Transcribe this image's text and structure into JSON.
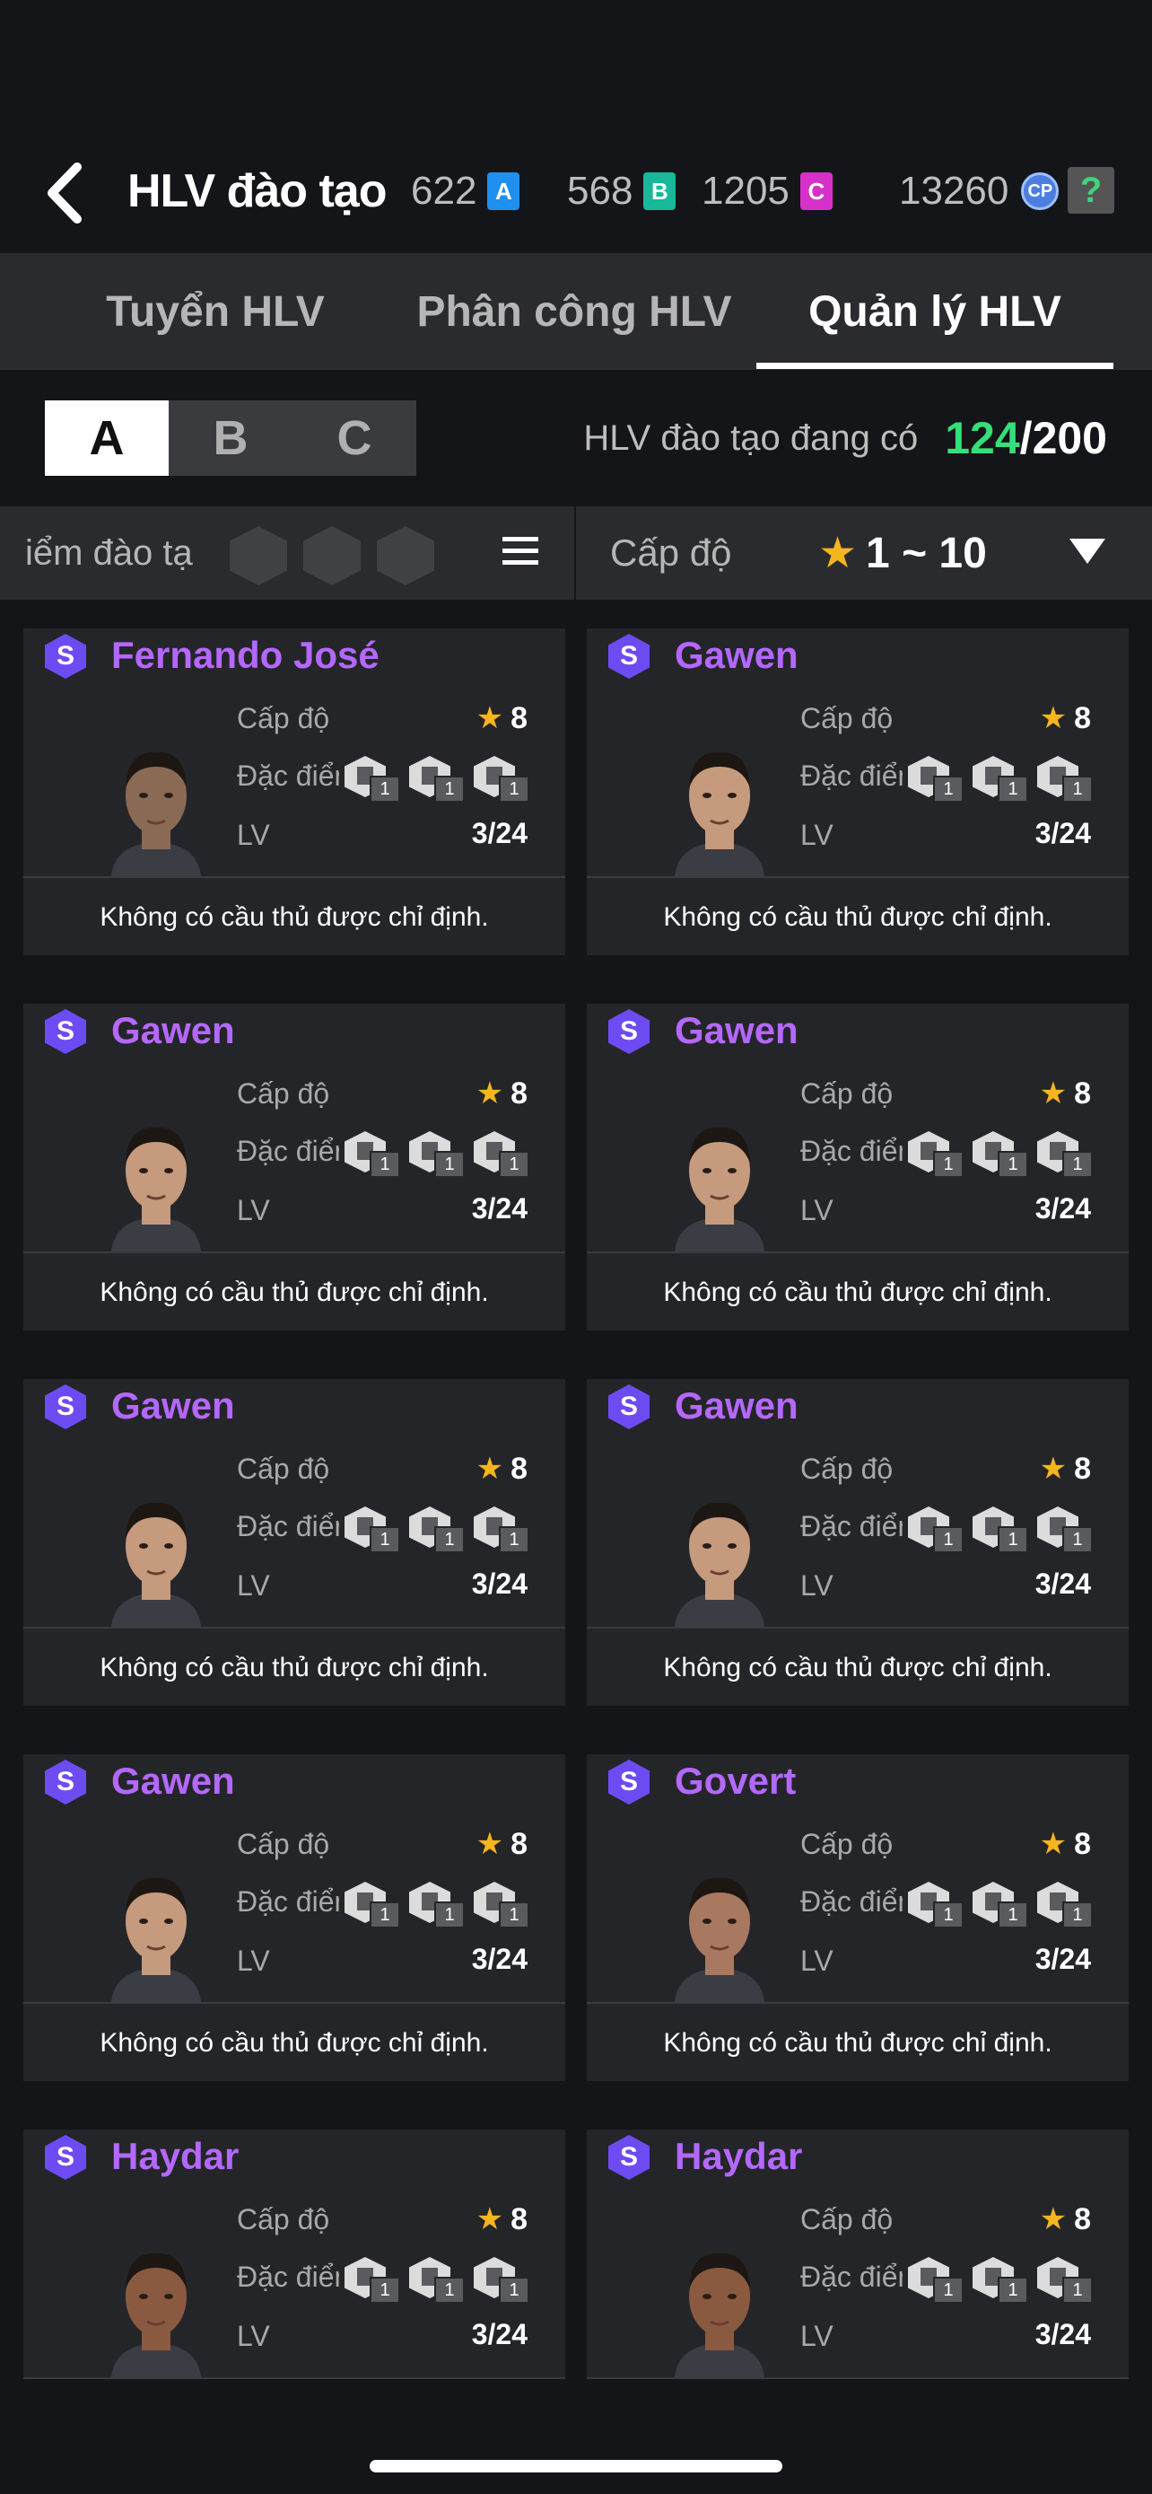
{
  "header": {
    "title": "HLV đào tạo",
    "currencies": [
      {
        "value": "622",
        "badge": "A",
        "color": "#1f8ff0"
      },
      {
        "value": "568",
        "badge": "B",
        "color": "#17b99a"
      },
      {
        "value": "1205",
        "badge": "C",
        "color": "#d531c8"
      }
    ],
    "cp_value": "13260",
    "cp_label": "CP",
    "help": "?"
  },
  "tabs": [
    {
      "label": "Tuyển HLV",
      "active": false
    },
    {
      "label": "Phân công HLV",
      "active": false
    },
    {
      "label": "Quản lý HLV",
      "active": true
    }
  ],
  "grade_tabs": [
    "A",
    "B",
    "C"
  ],
  "grade_selected": "A",
  "coach_count": {
    "label": "HLV đào tạo đang có",
    "current": "124",
    "max": "/200"
  },
  "filter": {
    "traits_label": "iểm đào tạ",
    "level_label": "Cấp độ",
    "level_star": "★",
    "level_range": "1 ~ 10"
  },
  "card_labels": {
    "level": "Cấp độ",
    "traits": "Đặc điểm",
    "lv": "LV",
    "rank_badge": "S"
  },
  "coaches": [
    {
      "name": "Fernando José",
      "stars": "8",
      "lv": "3/24",
      "note": "Không có cầu thủ được chỉ định.",
      "traits": [
        "1",
        "1",
        "1"
      ]
    },
    {
      "name": "Gawen",
      "stars": "8",
      "lv": "3/24",
      "note": "Không có cầu thủ được chỉ định.",
      "traits": [
        "1",
        "1",
        "1"
      ]
    },
    {
      "name": "Gawen",
      "stars": "8",
      "lv": "3/24",
      "note": "Không có cầu thủ được chỉ định.",
      "traits": [
        "1",
        "1",
        "1"
      ]
    },
    {
      "name": "Gawen",
      "stars": "8",
      "lv": "3/24",
      "note": "Không có cầu thủ được chỉ định.",
      "traits": [
        "1",
        "1",
        "1"
      ]
    },
    {
      "name": "Gawen",
      "stars": "8",
      "lv": "3/24",
      "note": "Không có cầu thủ được chỉ định.",
      "traits": [
        "1",
        "1",
        "1"
      ]
    },
    {
      "name": "Gawen",
      "stars": "8",
      "lv": "3/24",
      "note": "Không có cầu thủ được chỉ định.",
      "traits": [
        "1",
        "1",
        "1"
      ]
    },
    {
      "name": "Gawen",
      "stars": "8",
      "lv": "3/24",
      "note": "Không có cầu thủ được chỉ định.",
      "traits": [
        "1",
        "1",
        "1"
      ]
    },
    {
      "name": "Govert",
      "stars": "8",
      "lv": "3/24",
      "note": "Không có cầu thủ được chỉ định.",
      "traits": [
        "1",
        "1",
        "1"
      ]
    },
    {
      "name": "Haydar",
      "stars": "8",
      "lv": "3/24",
      "note": "",
      "traits": [
        "1",
        "1",
        "1"
      ]
    },
    {
      "name": "Haydar",
      "stars": "8",
      "lv": "3/24",
      "note": "",
      "traits": [
        "1",
        "1",
        "1"
      ]
    }
  ],
  "colors": {
    "accent": "#33e07a",
    "name": "#b468ff",
    "star": "#f5b51e",
    "background": "#141518"
  }
}
